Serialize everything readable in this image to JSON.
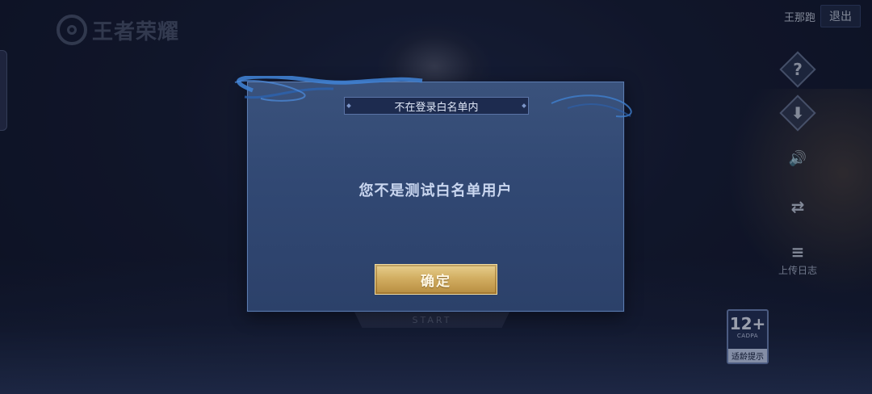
{
  "app": {
    "logo_text": "王者荣耀"
  },
  "header": {
    "username": "王那跑",
    "logout_label": "退出"
  },
  "right_toolbar": {
    "items": [
      {
        "icon": "question-icon",
        "glyph": "?"
      },
      {
        "icon": "download-icon",
        "glyph": "⬇"
      },
      {
        "icon": "speaker-icon",
        "glyph": "🔊"
      },
      {
        "icon": "phone-switch-icon",
        "glyph": "⇄"
      },
      {
        "icon": "log-icon",
        "glyph": "≡"
      }
    ],
    "upload_log_label": "上传日志"
  },
  "start_label": "START",
  "rating": {
    "age": "12+",
    "org": "CADPA",
    "tip": "适龄提示"
  },
  "dialog": {
    "title": "不在登录白名单内",
    "message": "您不是测试白名单用户",
    "confirm_label": "确定"
  },
  "colors": {
    "dialog_bg": "#314873",
    "button_gold": "#d2ae62",
    "background": "#151c33"
  }
}
